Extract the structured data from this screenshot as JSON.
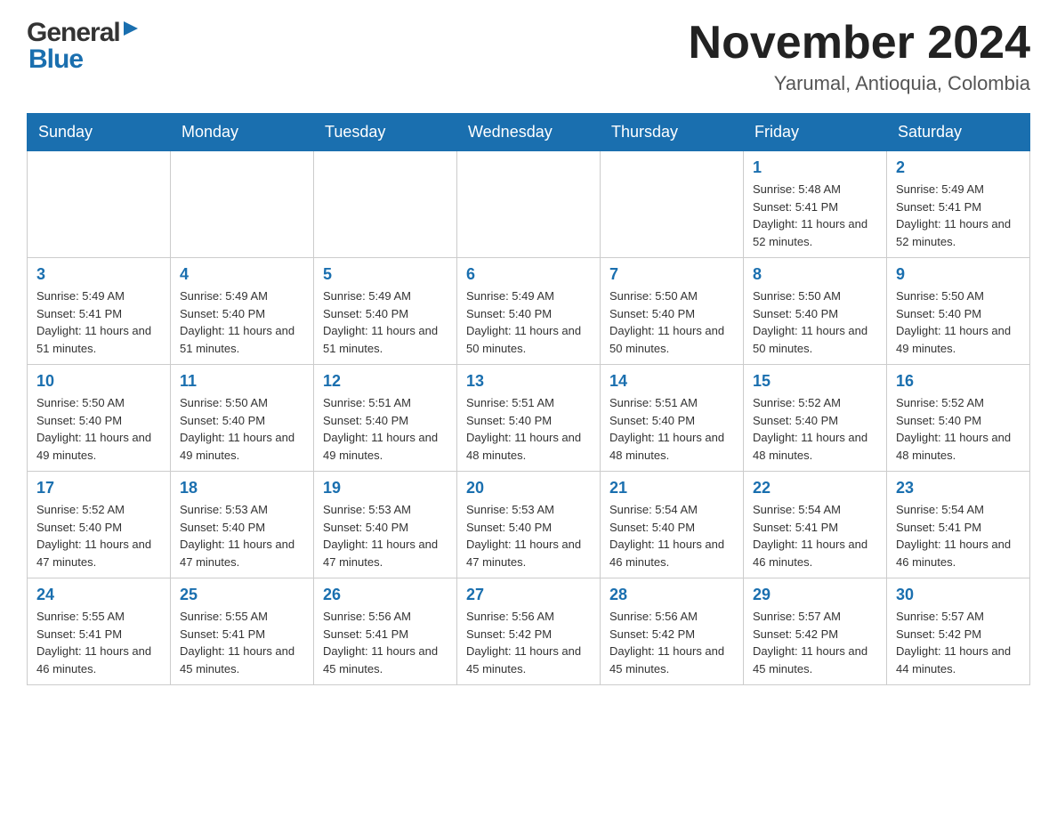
{
  "header": {
    "month_title": "November 2024",
    "location": "Yarumal, Antioquia, Colombia",
    "logo_general": "General",
    "logo_blue": "Blue"
  },
  "days_of_week": [
    "Sunday",
    "Monday",
    "Tuesday",
    "Wednesday",
    "Thursday",
    "Friday",
    "Saturday"
  ],
  "weeks": [
    [
      {
        "day": "",
        "info": ""
      },
      {
        "day": "",
        "info": ""
      },
      {
        "day": "",
        "info": ""
      },
      {
        "day": "",
        "info": ""
      },
      {
        "day": "",
        "info": ""
      },
      {
        "day": "1",
        "info": "Sunrise: 5:48 AM\nSunset: 5:41 PM\nDaylight: 11 hours and 52 minutes."
      },
      {
        "day": "2",
        "info": "Sunrise: 5:49 AM\nSunset: 5:41 PM\nDaylight: 11 hours and 52 minutes."
      }
    ],
    [
      {
        "day": "3",
        "info": "Sunrise: 5:49 AM\nSunset: 5:41 PM\nDaylight: 11 hours and 51 minutes."
      },
      {
        "day": "4",
        "info": "Sunrise: 5:49 AM\nSunset: 5:40 PM\nDaylight: 11 hours and 51 minutes."
      },
      {
        "day": "5",
        "info": "Sunrise: 5:49 AM\nSunset: 5:40 PM\nDaylight: 11 hours and 51 minutes."
      },
      {
        "day": "6",
        "info": "Sunrise: 5:49 AM\nSunset: 5:40 PM\nDaylight: 11 hours and 50 minutes."
      },
      {
        "day": "7",
        "info": "Sunrise: 5:50 AM\nSunset: 5:40 PM\nDaylight: 11 hours and 50 minutes."
      },
      {
        "day": "8",
        "info": "Sunrise: 5:50 AM\nSunset: 5:40 PM\nDaylight: 11 hours and 50 minutes."
      },
      {
        "day": "9",
        "info": "Sunrise: 5:50 AM\nSunset: 5:40 PM\nDaylight: 11 hours and 49 minutes."
      }
    ],
    [
      {
        "day": "10",
        "info": "Sunrise: 5:50 AM\nSunset: 5:40 PM\nDaylight: 11 hours and 49 minutes."
      },
      {
        "day": "11",
        "info": "Sunrise: 5:50 AM\nSunset: 5:40 PM\nDaylight: 11 hours and 49 minutes."
      },
      {
        "day": "12",
        "info": "Sunrise: 5:51 AM\nSunset: 5:40 PM\nDaylight: 11 hours and 49 minutes."
      },
      {
        "day": "13",
        "info": "Sunrise: 5:51 AM\nSunset: 5:40 PM\nDaylight: 11 hours and 48 minutes."
      },
      {
        "day": "14",
        "info": "Sunrise: 5:51 AM\nSunset: 5:40 PM\nDaylight: 11 hours and 48 minutes."
      },
      {
        "day": "15",
        "info": "Sunrise: 5:52 AM\nSunset: 5:40 PM\nDaylight: 11 hours and 48 minutes."
      },
      {
        "day": "16",
        "info": "Sunrise: 5:52 AM\nSunset: 5:40 PM\nDaylight: 11 hours and 48 minutes."
      }
    ],
    [
      {
        "day": "17",
        "info": "Sunrise: 5:52 AM\nSunset: 5:40 PM\nDaylight: 11 hours and 47 minutes."
      },
      {
        "day": "18",
        "info": "Sunrise: 5:53 AM\nSunset: 5:40 PM\nDaylight: 11 hours and 47 minutes."
      },
      {
        "day": "19",
        "info": "Sunrise: 5:53 AM\nSunset: 5:40 PM\nDaylight: 11 hours and 47 minutes."
      },
      {
        "day": "20",
        "info": "Sunrise: 5:53 AM\nSunset: 5:40 PM\nDaylight: 11 hours and 47 minutes."
      },
      {
        "day": "21",
        "info": "Sunrise: 5:54 AM\nSunset: 5:40 PM\nDaylight: 11 hours and 46 minutes."
      },
      {
        "day": "22",
        "info": "Sunrise: 5:54 AM\nSunset: 5:41 PM\nDaylight: 11 hours and 46 minutes."
      },
      {
        "day": "23",
        "info": "Sunrise: 5:54 AM\nSunset: 5:41 PM\nDaylight: 11 hours and 46 minutes."
      }
    ],
    [
      {
        "day": "24",
        "info": "Sunrise: 5:55 AM\nSunset: 5:41 PM\nDaylight: 11 hours and 46 minutes."
      },
      {
        "day": "25",
        "info": "Sunrise: 5:55 AM\nSunset: 5:41 PM\nDaylight: 11 hours and 45 minutes."
      },
      {
        "day": "26",
        "info": "Sunrise: 5:56 AM\nSunset: 5:41 PM\nDaylight: 11 hours and 45 minutes."
      },
      {
        "day": "27",
        "info": "Sunrise: 5:56 AM\nSunset: 5:42 PM\nDaylight: 11 hours and 45 minutes."
      },
      {
        "day": "28",
        "info": "Sunrise: 5:56 AM\nSunset: 5:42 PM\nDaylight: 11 hours and 45 minutes."
      },
      {
        "day": "29",
        "info": "Sunrise: 5:57 AM\nSunset: 5:42 PM\nDaylight: 11 hours and 45 minutes."
      },
      {
        "day": "30",
        "info": "Sunrise: 5:57 AM\nSunset: 5:42 PM\nDaylight: 11 hours and 44 minutes."
      }
    ]
  ]
}
